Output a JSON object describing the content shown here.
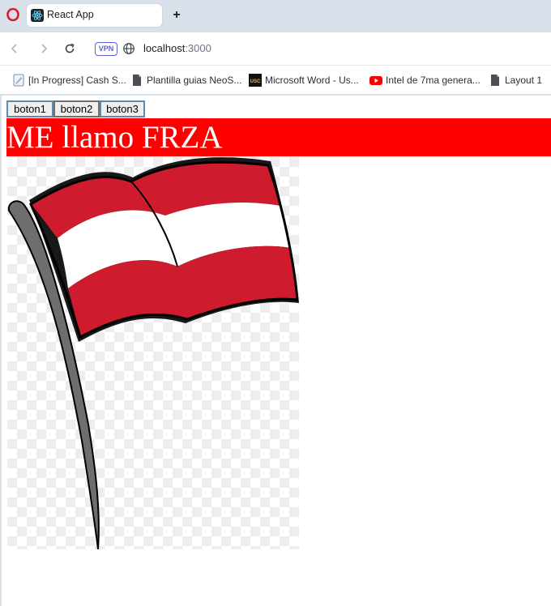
{
  "browser": {
    "tab": {
      "title": "React App"
    },
    "new_tab_label": "+",
    "vpn_label": "VPN",
    "address": {
      "host": "localhost",
      "port": ":3000"
    },
    "bookmarks": [
      {
        "label": "[In Progress] Cash S...",
        "icon": "document-pencil-icon"
      },
      {
        "label": "Plantilla guias NeoS...",
        "icon": "file-icon"
      },
      {
        "label": "Microsoft Word - Us...",
        "icon": "usc-logo-icon"
      },
      {
        "label": "Intel de 7ma genera...",
        "icon": "youtube-icon"
      },
      {
        "label": "Layout 1",
        "icon": "file-icon"
      }
    ]
  },
  "page": {
    "buttons": [
      {
        "label": "boton1"
      },
      {
        "label": "boton2"
      },
      {
        "label": "boton3"
      }
    ],
    "heading": "ME llamo FRZA",
    "heading_bg": "#ff0000",
    "image": {
      "description_icon": "austria-flag-image"
    },
    "flag_colors": {
      "red": "#cf1b2e",
      "white": "#ffffff",
      "pole": "#6e6e6e"
    }
  }
}
